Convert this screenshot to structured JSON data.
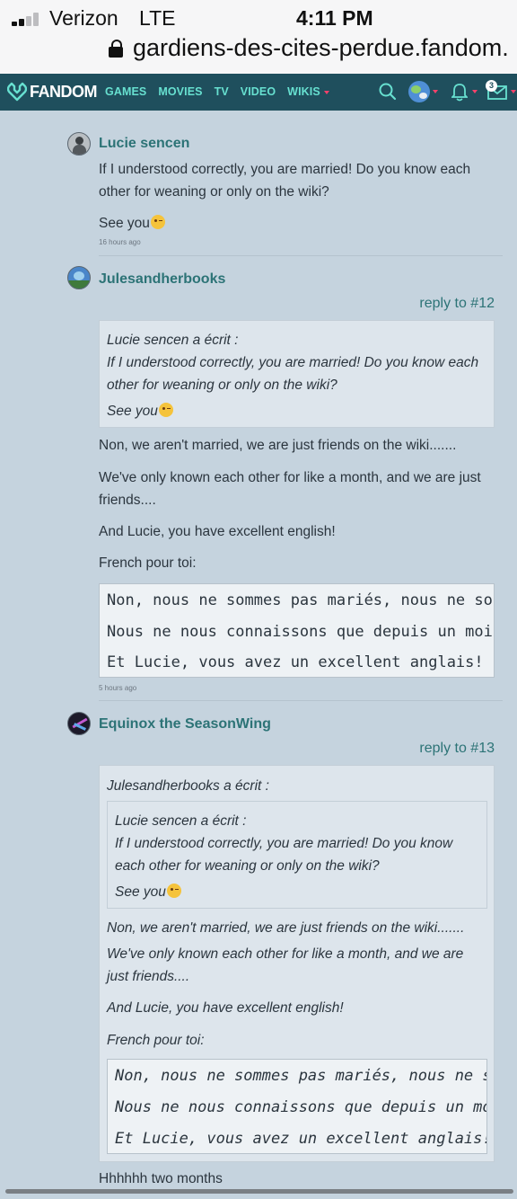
{
  "status_bar": {
    "carrier": "Verizon",
    "network": "LTE",
    "time": "4:11 PM",
    "signal_bars": 2
  },
  "url_bar": {
    "url": "gardiens-des-cites-perdue.fandom.",
    "secure": true
  },
  "nav": {
    "brand": "FANDOM",
    "links": [
      "GAMES",
      "MOVIES",
      "TV",
      "VIDEO",
      "WIKIS"
    ],
    "notification_count": "3",
    "accent": "#67e0d0",
    "bar_color": "#1f4f5d"
  },
  "comments": [
    {
      "author": "Lucie sencen",
      "paragraphs": [
        "If I understood correctly, you are married! Do you know each other for weaning or only on the wiki?",
        "See you"
      ],
      "time": "16 hours ago"
    },
    {
      "author": "Julesandherbooks",
      "reply_to": "reply to #12",
      "quote": {
        "heading": "Lucie sencen a écrit :",
        "lines": [
          "If I understood correctly, you are married! Do you know each",
          "other for weaning or only on the wiki?",
          "See you"
        ]
      },
      "paragraphs": [
        "Non, we aren't married, we are just friends on the wiki.......",
        "We've only known each other for like a month, and we are just friends....",
        "And Lucie, you have excellent english!",
        "French pour toi:"
      ],
      "code_lines": [
        "Non, nous ne sommes pas mariés, nous ne so",
        "Nous ne nous connaissons que depuis un moi",
        "Et Lucie, vous avez un excellent anglais!"
      ],
      "time": "5 hours ago"
    },
    {
      "author": "Equinox the SeasonWing",
      "reply_to": "reply to #13",
      "quote": {
        "heading": "Julesandherbooks a écrit :",
        "inner_heading": "Lucie sencen a écrit :",
        "inner_lines": [
          "If I understood correctly, you are married! Do you know",
          "each other for weaning or only on the wiki?",
          "See you"
        ],
        "lines": [
          "Non, we aren't married, we are just friends on the wiki.......",
          "We've only known each other for like a month, and we are",
          "just friends....",
          "And Lucie, you have excellent english!",
          "French pour toi:"
        ],
        "code_lines": [
          "Non, nous ne sommes pas mariés, nous ne s",
          "Nous ne nous connaissons que depuis un mo",
          "Et Lucie, vous avez un excellent anglais!"
        ]
      },
      "paragraphs": [
        "Hhhhhh two months"
      ]
    }
  ]
}
